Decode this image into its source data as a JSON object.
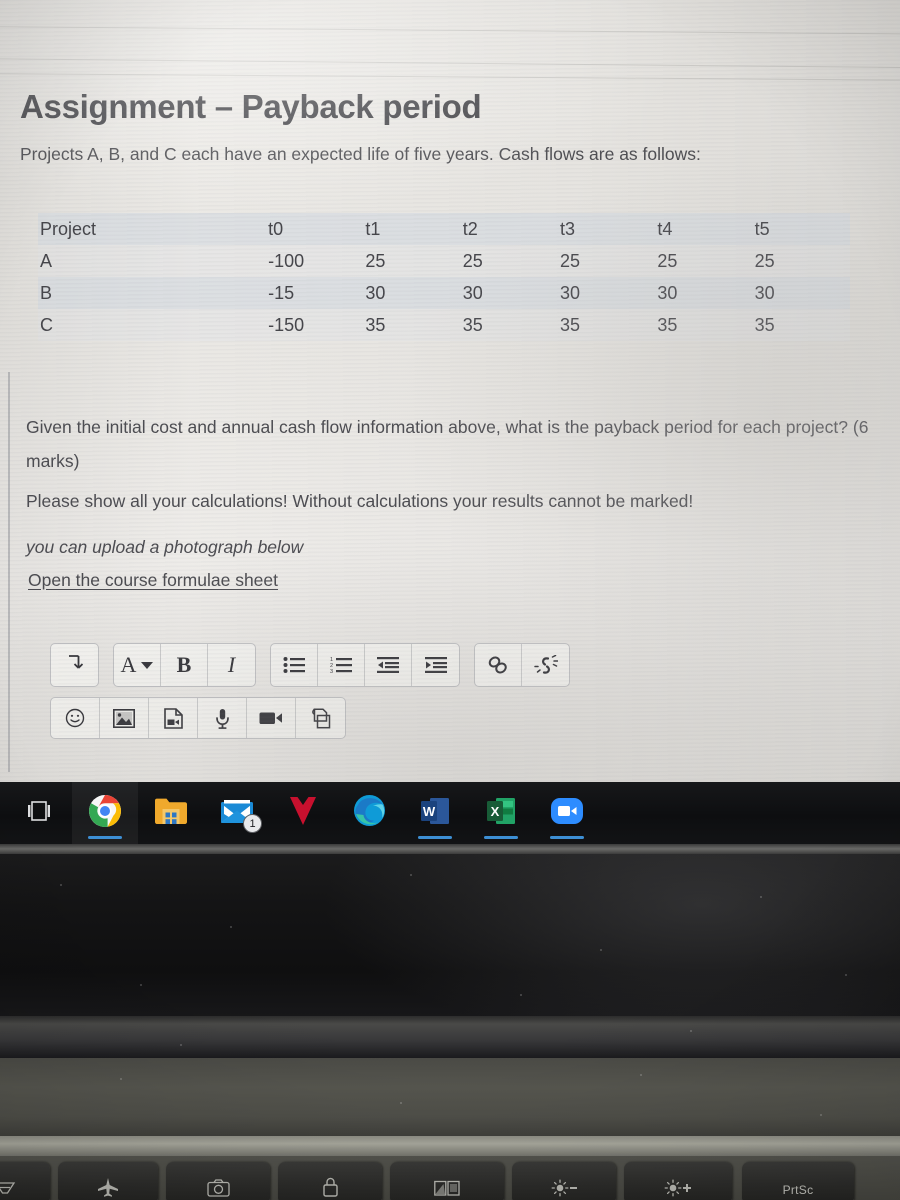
{
  "document": {
    "title": "Assignment – Payback period",
    "intro": "Projects A, B, and C each have an expected life of five years. Cash flows are as follows:",
    "question": "Given the initial cost and annual cash flow information above, what is the payback period for each project? (6 marks)",
    "show_calculations": "Please show all your calculations! Without calculations your results cannot be marked!",
    "upload_note": "you can upload a photograph below",
    "formulae_link": "Open the course formulae sheet"
  },
  "table": {
    "headers": [
      "Project",
      "t0",
      "t1",
      "t2",
      "t3",
      "t4",
      "t5"
    ],
    "rows": [
      {
        "project": "A",
        "values": [
          "-100",
          "25",
          "25",
          "25",
          "25",
          "25"
        ]
      },
      {
        "project": "B",
        "values": [
          "-15",
          "30",
          "30",
          "30",
          "30",
          "30"
        ]
      },
      {
        "project": "C",
        "values": [
          "-150",
          "35",
          "35",
          "35",
          "35",
          "35"
        ]
      }
    ]
  },
  "toolbar": {
    "row1": [
      {
        "group": 1,
        "name": "insert-break",
        "icon": "arrow-down-turn-icon",
        "label": ""
      },
      {
        "group": 2,
        "name": "text-color",
        "icon": "font-color-dropdown-icon",
        "label": "A"
      },
      {
        "group": 2,
        "name": "bold",
        "icon": "bold-icon",
        "label": "B"
      },
      {
        "group": 2,
        "name": "italic",
        "icon": "italic-icon",
        "label": "I"
      },
      {
        "group": 3,
        "name": "bulleted-list",
        "icon": "bulleted-list-icon",
        "label": ""
      },
      {
        "group": 3,
        "name": "numbered-list",
        "icon": "numbered-list-icon",
        "label": ""
      },
      {
        "group": 3,
        "name": "outdent",
        "icon": "outdent-icon",
        "label": ""
      },
      {
        "group": 3,
        "name": "indent",
        "icon": "indent-icon",
        "label": ""
      },
      {
        "group": 4,
        "name": "insert-link",
        "icon": "link-icon",
        "label": ""
      },
      {
        "group": 4,
        "name": "remove-link",
        "icon": "broken-link-icon",
        "label": ""
      }
    ],
    "row2": [
      {
        "name": "insert-emoji",
        "icon": "smiley-icon"
      },
      {
        "name": "insert-image",
        "icon": "image-icon"
      },
      {
        "name": "insert-media-file",
        "icon": "media-file-icon"
      },
      {
        "name": "record-audio",
        "icon": "microphone-icon"
      },
      {
        "name": "record-video",
        "icon": "video-camera-icon"
      },
      {
        "name": "duplicate-content",
        "icon": "copy-pages-icon"
      }
    ]
  },
  "taskbar": {
    "items": [
      {
        "name": "task-view",
        "icon": "task-view-icon",
        "badge": "",
        "active": false,
        "highlight": false
      },
      {
        "name": "google-chrome",
        "icon": "chrome-icon",
        "badge": "",
        "active": true,
        "highlight": true
      },
      {
        "name": "file-explorer",
        "icon": "folder-icon",
        "badge": "",
        "active": false,
        "highlight": false
      },
      {
        "name": "mail",
        "icon": "mail-icon",
        "badge": "1",
        "active": false,
        "highlight": false
      },
      {
        "name": "mcafee",
        "icon": "mcafee-shield-icon",
        "badge": "",
        "active": false,
        "highlight": false
      },
      {
        "name": "microsoft-edge",
        "icon": "edge-icon",
        "badge": "",
        "active": false,
        "highlight": false
      },
      {
        "name": "microsoft-word",
        "icon": "word-icon",
        "badge": "",
        "active": true,
        "highlight": false
      },
      {
        "name": "microsoft-excel",
        "icon": "excel-icon",
        "badge": "",
        "active": true,
        "highlight": false
      },
      {
        "name": "zoom",
        "icon": "zoom-camera-icon",
        "badge": "",
        "active": true,
        "highlight": false
      }
    ]
  },
  "keyboard": {
    "keys": [
      {
        "name": "key-projector",
        "icon": "projector-icon",
        "label": ""
      },
      {
        "name": "key-airplane-mode",
        "icon": "airplane-icon",
        "label": ""
      },
      {
        "name": "key-camera",
        "icon": "camera-icon",
        "label": ""
      },
      {
        "name": "key-lock",
        "icon": "padlock-icon",
        "label": ""
      },
      {
        "name": "key-display-switch",
        "icon": "dual-display-icon",
        "label": ""
      },
      {
        "name": "key-brightness-down",
        "icon": "brightness-down-icon",
        "label": ""
      },
      {
        "name": "key-brightness-up",
        "icon": "brightness-up-icon",
        "label": ""
      },
      {
        "name": "key-print-screen",
        "icon": "",
        "label": "PrtSc"
      }
    ]
  },
  "colors": {
    "screen_bg": "#eceae6",
    "text": "#4a4a4f",
    "table_stripe": "#cdd6e0",
    "taskbar_bg": "#0d0e10",
    "taskbar_active_underline": "#3d8fd4",
    "chrome_blue": "#4285f4",
    "edge_blue": "#0f9bd7",
    "word_blue": "#2b579a",
    "excel_green": "#217346",
    "mcafee_red": "#c8102e",
    "zoom_blue": "#2d8cff"
  }
}
